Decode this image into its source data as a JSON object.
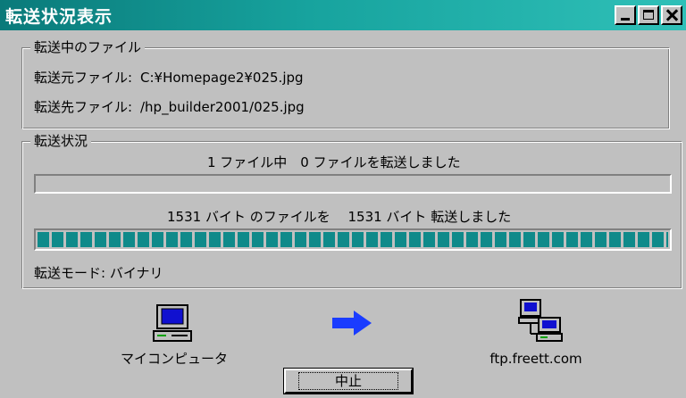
{
  "window": {
    "title": "転送状況表示"
  },
  "file_group": {
    "legend": "転送中のファイル",
    "source_label": "転送元ファイル:",
    "source_value": "C:¥Homepage2¥025.jpg",
    "dest_label": "転送先ファイル:",
    "dest_value": "/hp_builder2001/025.jpg"
  },
  "status_group": {
    "legend": "転送状況",
    "files_status": "1 ファイル中　0 ファイルを転送しました",
    "files_progress": 0.0,
    "bytes_status": "1531 バイト のファイルを　 1531 バイト 転送しました",
    "bytes_progress": 1.0,
    "mode_text": "転送モード: バイナリ"
  },
  "transfer": {
    "local_label": "マイコンピュータ",
    "remote_label": "ftp.freett.com",
    "local_icon": "computer-icon",
    "arrow_icon": "arrow-right-icon",
    "remote_icon": "network-server-icon"
  },
  "actions": {
    "cancel_label": "中止"
  },
  "colors": {
    "titlebar": "#0a7a7a",
    "progress": "#0f8a8a",
    "arrow": "#1a3cff"
  }
}
